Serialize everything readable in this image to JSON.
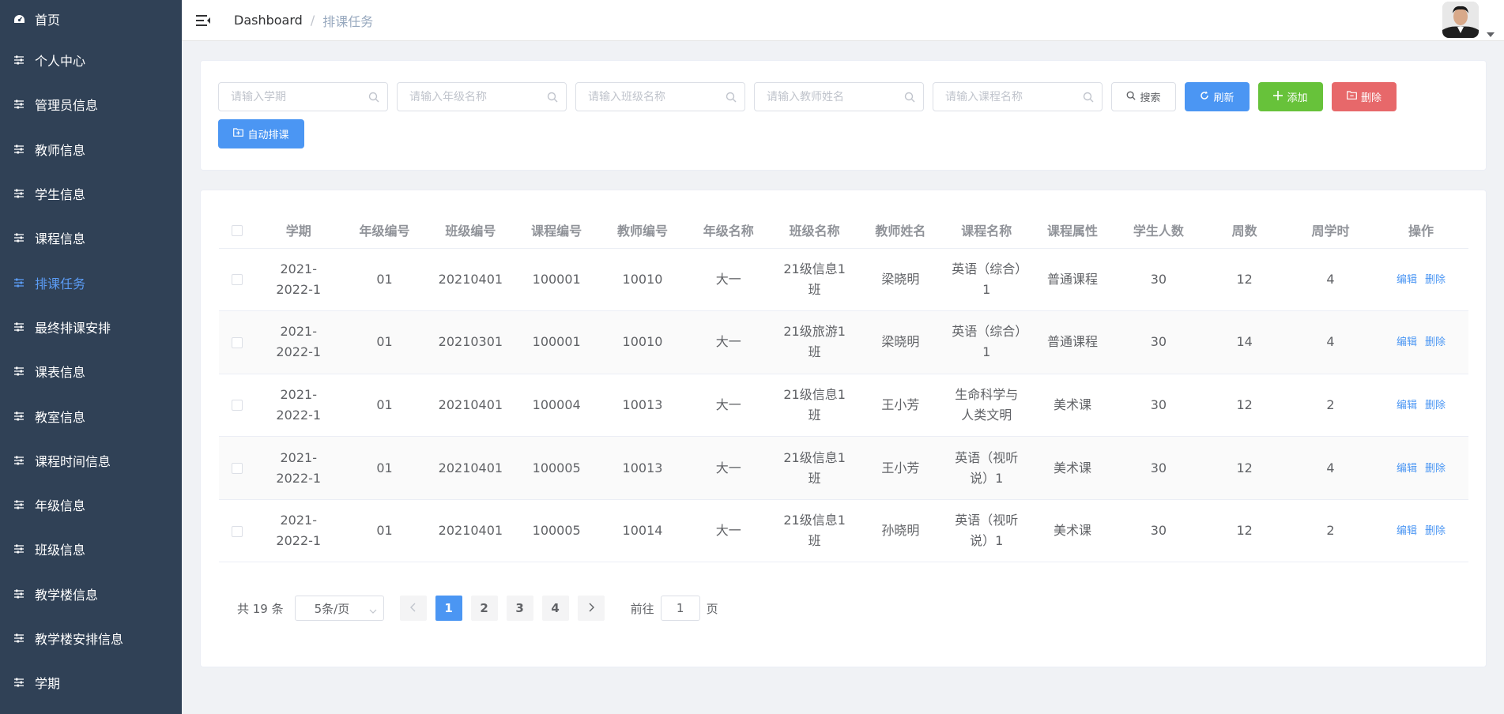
{
  "sidebar": {
    "items": [
      {
        "label": "首页",
        "icon": "dashboard-icon"
      },
      {
        "label": "个人中心",
        "icon": "sliders-icon"
      },
      {
        "label": "管理员信息",
        "icon": "sliders-icon"
      },
      {
        "label": "教师信息",
        "icon": "sliders-icon"
      },
      {
        "label": "学生信息",
        "icon": "sliders-icon"
      },
      {
        "label": "课程信息",
        "icon": "sliders-icon"
      },
      {
        "label": "排课任务",
        "icon": "sliders-icon",
        "active": true
      },
      {
        "label": "最终排课安排",
        "icon": "sliders-icon"
      },
      {
        "label": "课表信息",
        "icon": "sliders-icon"
      },
      {
        "label": "教室信息",
        "icon": "sliders-icon"
      },
      {
        "label": "课程时间信息",
        "icon": "sliders-icon"
      },
      {
        "label": "年级信息",
        "icon": "sliders-icon"
      },
      {
        "label": "班级信息",
        "icon": "sliders-icon"
      },
      {
        "label": "教学楼信息",
        "icon": "sliders-icon"
      },
      {
        "label": "教学楼安排信息",
        "icon": "sliders-icon"
      },
      {
        "label": "学期",
        "icon": "sliders-icon"
      }
    ],
    "active_color": "#5b9cf5",
    "background": "#304156"
  },
  "header": {
    "breadcrumb_home": "Dashboard",
    "breadcrumb_sep": "/",
    "breadcrumb_current": "排课任务"
  },
  "filters": {
    "semester_placeholder": "请输入学期",
    "grade_placeholder": "请输入年级名称",
    "class_placeholder": "请输入班级名称",
    "teacher_placeholder": "请输入教师姓名",
    "course_placeholder": "请输入课程名称",
    "search_label": "搜索",
    "refresh_label": "刷新",
    "add_label": "添加",
    "delete_label": "删除",
    "auto_label": "自动排课"
  },
  "table": {
    "columns": [
      "学期",
      "年级编号",
      "班级编号",
      "课程编号",
      "教师编号",
      "年级名称",
      "班级名称",
      "教师姓名",
      "课程名称",
      "课程属性",
      "学生人数",
      "周数",
      "周学时",
      "操作"
    ],
    "rows": [
      [
        "2021-2022-1",
        "01",
        "20210401",
        "100001",
        "10010",
        "大一",
        "21级信息1班",
        "梁晓明",
        "英语（综合）1",
        "普通课程",
        "30",
        "12",
        "4"
      ],
      [
        "2021-2022-1",
        "01",
        "20210301",
        "100001",
        "10010",
        "大一",
        "21级旅游1班",
        "梁晓明",
        "英语（综合）1",
        "普通课程",
        "30",
        "14",
        "4"
      ],
      [
        "2021-2022-1",
        "01",
        "20210401",
        "100004",
        "10013",
        "大一",
        "21级信息1班",
        "王小芳",
        "生命科学与人类文明",
        "美术课",
        "30",
        "12",
        "2"
      ],
      [
        "2021-2022-1",
        "01",
        "20210401",
        "100005",
        "10013",
        "大一",
        "21级信息1班",
        "王小芳",
        "英语（视听说）1",
        "美术课",
        "30",
        "12",
        "4"
      ],
      [
        "2021-2022-1",
        "01",
        "20210401",
        "100005",
        "10014",
        "大一",
        "21级信息1班",
        "孙晓明",
        "英语（视听说）1",
        "美术课",
        "30",
        "12",
        "2"
      ]
    ],
    "edit_label": "编辑",
    "delete_label": "删除"
  },
  "pagination": {
    "total": "共 19 条",
    "page_size": "5条/页",
    "pages": [
      "1",
      "2",
      "3",
      "4"
    ],
    "current_page": "1",
    "goto_label": "前往",
    "goto_value": "1",
    "page_suffix": "页"
  },
  "colors": {
    "primary": "#4b96f3",
    "success": "#67c23a",
    "danger": "#e7686a"
  }
}
